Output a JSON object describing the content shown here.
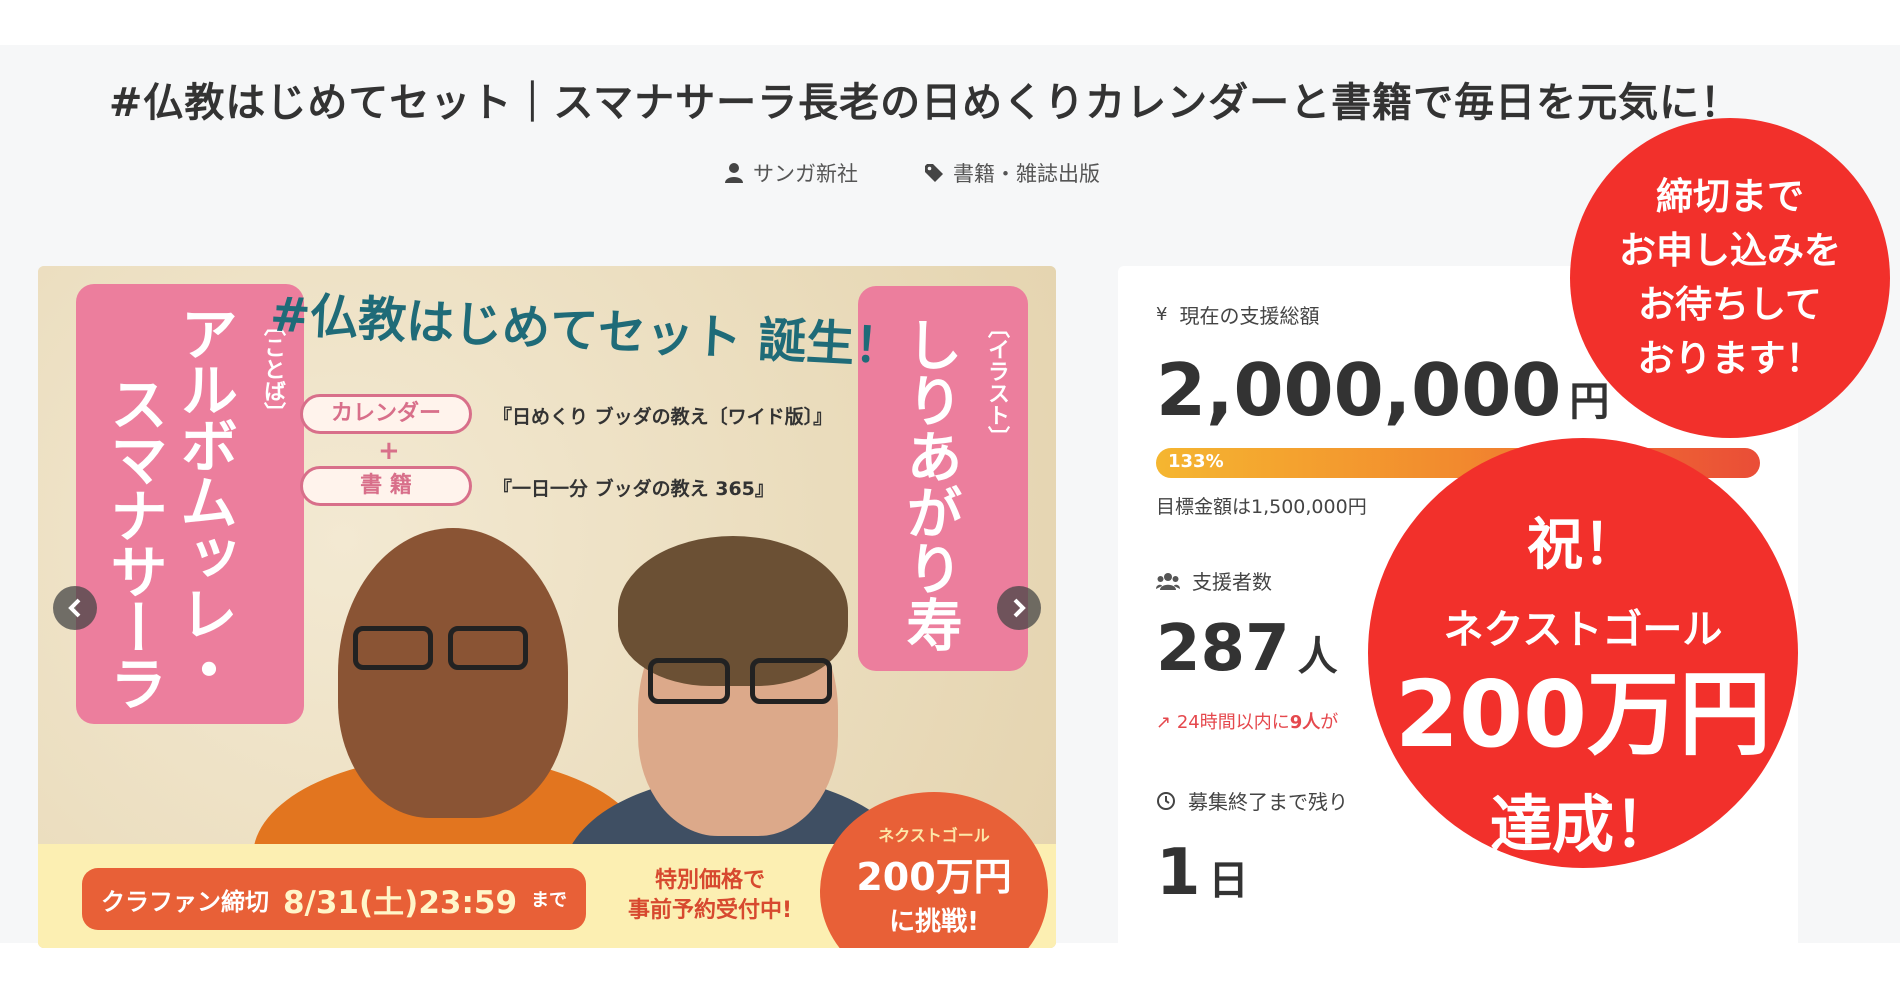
{
  "page": {
    "title": "#仏教はじめてセット｜スマナサーラ長老の日めくりカレンダーと書籍で毎日を元気に！",
    "author": "サンガ新社",
    "category": "書籍・雑誌出版",
    "author_icon": "person-icon",
    "category_icon": "tag-icon"
  },
  "hero": {
    "title": "#仏教はじめてセット 誕生！",
    "left_bubble_small": "〔ことば〕",
    "left_bubble_line1": "アルボムッレ・",
    "left_bubble_line2": "スマナサーラ",
    "right_bubble_small": "〔イラスト〕",
    "right_bubble_name": "しりあがり寿",
    "item1_label": "カレンダー",
    "item1_product": "『日めくり ブッダの教え〔ワイド版〕』",
    "plus": "+",
    "item2_label": "書 籍",
    "item2_product": "『一日一分 ブッダの教え 365』",
    "deadline_label": "クラファン締切",
    "deadline_date": "8/31(土)23:59",
    "deadline_until": "まで",
    "special_line1": "特別価格で",
    "special_line2": "事前予約受付中!",
    "badge_line1": "ネクストゴール",
    "badge_line2": "200万円",
    "badge_line3": "に挑戦!",
    "prev_icon": "chevron-left-icon",
    "next_icon": "chevron-right-icon"
  },
  "stats": {
    "total_label": "現在の支援総額",
    "total_icon": "yen-icon",
    "total_value": "2,000,000",
    "total_unit": "円",
    "progress_text": "133%",
    "progress_percent": 133,
    "goal_text": "目標金額は1,500,000円",
    "backers_label": "支援者数",
    "backers_icon": "users-icon",
    "backers_value": "287",
    "backers_unit": "人",
    "trend_prefix": "24時間以内に",
    "trend_count": "9人",
    "trend_suffix": "が",
    "trend_icon": "trending-up-icon",
    "remaining_label": "募集終了まで残り",
    "remaining_icon": "clock-icon",
    "remaining_value": "1",
    "remaining_unit": "日"
  },
  "overlays": {
    "top_circle_lines": [
      "締切まで",
      "お申し込みを",
      "お待ちして",
      "おります！"
    ],
    "big_circle_line1": "祝！",
    "big_circle_line2": "ネクストゴール",
    "big_circle_line3": "200万円",
    "big_circle_line4": "達成！"
  },
  "colors": {
    "overlay_red": "#f2302b",
    "bubble_pink": "#ec7e9d",
    "accent_orange": "#e86037",
    "trend_red": "#e5484d"
  }
}
